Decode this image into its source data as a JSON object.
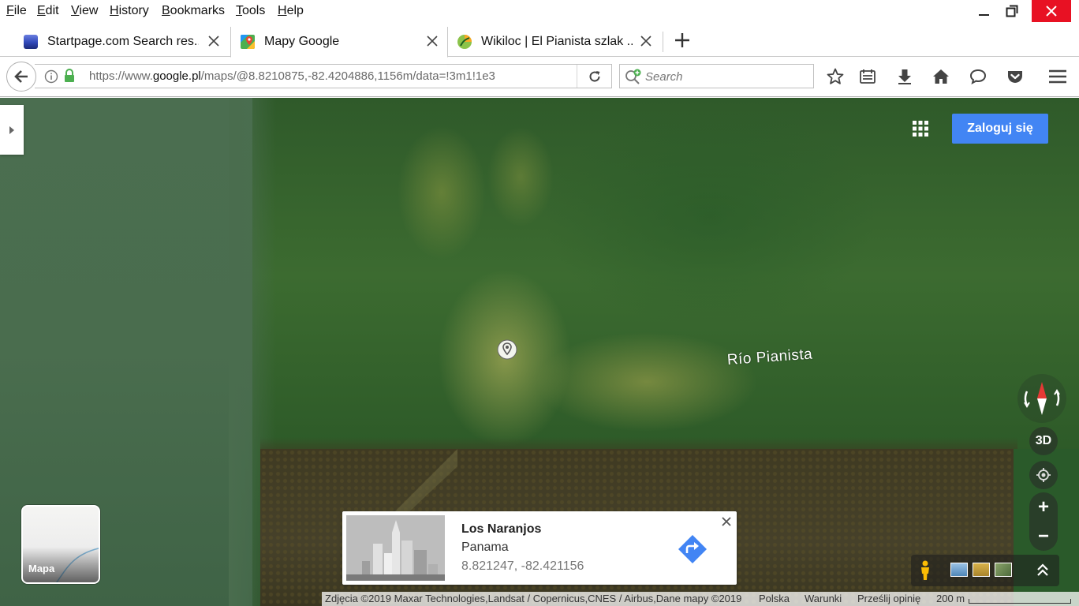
{
  "menubar": {
    "items": [
      "File",
      "Edit",
      "View",
      "History",
      "Bookmarks",
      "Tools",
      "Help"
    ]
  },
  "tabs": [
    {
      "title": "Startpage.com Search res...",
      "icon": "startpage-favicon",
      "active": false
    },
    {
      "title": "Mapy Google",
      "icon": "google-maps-favicon",
      "active": true
    },
    {
      "title": "Wikiloc | El Pianista szlak ...",
      "icon": "wikiloc-favicon",
      "active": false
    }
  ],
  "navbar": {
    "url_prefix": "https://www.",
    "url_domain": "google.pl",
    "url_rest": "/maps/@8.8210875,-82.4204886,1156m/data=!3m1!1e3",
    "search_placeholder": "Search"
  },
  "map": {
    "login_label": "Zaloguj się",
    "river_label": "Río Pianista",
    "btn_3d": "3D",
    "zoom_in": "+",
    "zoom_out": "−",
    "minimap_label": "Mapa",
    "place": {
      "name": "Los Naranjos",
      "country": "Panama",
      "coords": "8.821247, -82.421156"
    },
    "attribution": {
      "imagery": "Zdjęcia ©2019 Maxar Technologies,Landsat / Copernicus,CNES / Airbus,Dane mapy ©2019",
      "country": "Polska",
      "terms": "Warunki",
      "feedback": "Prześlij opinię",
      "scale": "200 m"
    }
  },
  "colors": {
    "accent_blue": "#4285f4",
    "close_red": "#e81123",
    "lock_green": "#4caf50"
  }
}
